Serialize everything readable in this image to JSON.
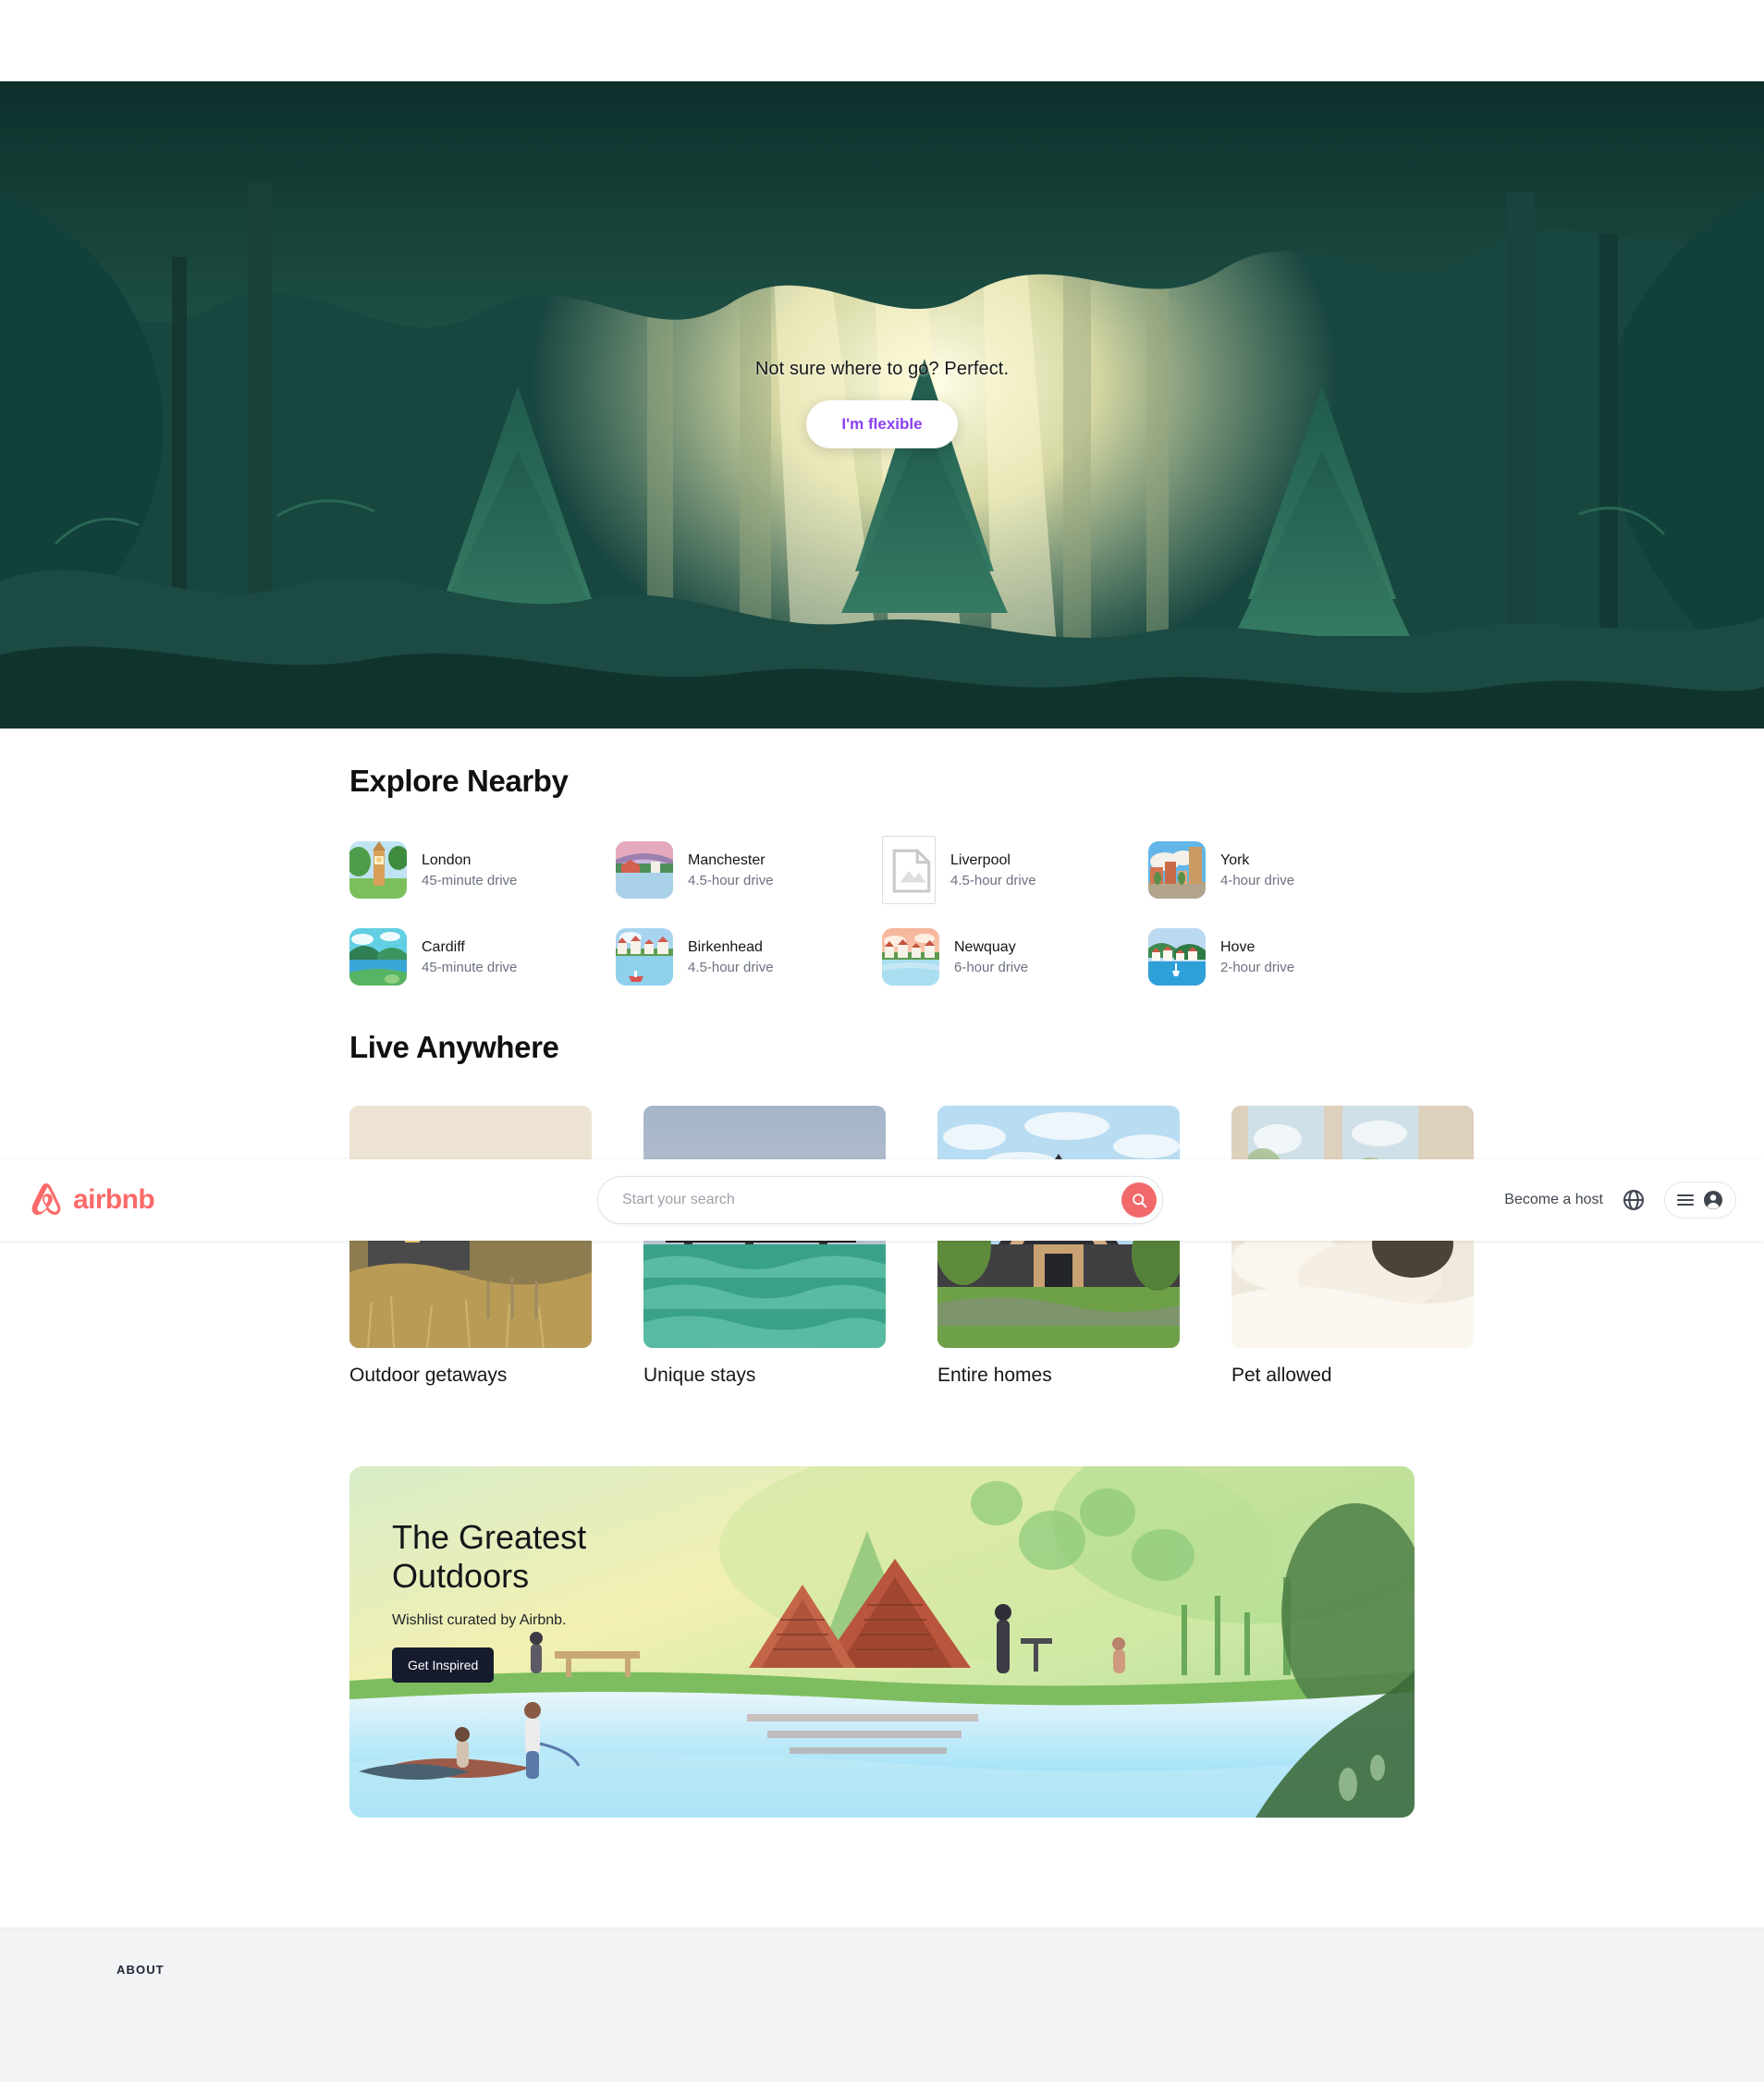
{
  "hero": {
    "caption": "Not sure where to go? Perfect.",
    "cta_label": "I'm flexible"
  },
  "explore": {
    "title": "Explore Nearby",
    "cities": [
      {
        "name": "London",
        "distance": "45-minute drive",
        "thumb": "london-thumb"
      },
      {
        "name": "Manchester",
        "distance": "4.5-hour drive",
        "thumb": "manchester-thumb"
      },
      {
        "name": "Liverpool",
        "distance": "4.5-hour drive",
        "thumb": "broken-image"
      },
      {
        "name": "York",
        "distance": "4-hour drive",
        "thumb": "york-thumb"
      },
      {
        "name": "Cardiff",
        "distance": "45-minute drive",
        "thumb": "cardiff-thumb"
      },
      {
        "name": "Birkenhead",
        "distance": "4.5-hour drive",
        "thumb": "birkenhead-thumb"
      },
      {
        "name": "Newquay",
        "distance": "6-hour drive",
        "thumb": "newquay-thumb"
      },
      {
        "name": "Hove",
        "distance": "2-hour drive",
        "thumb": "hove-thumb"
      }
    ]
  },
  "live_anywhere": {
    "title": "Live Anywhere",
    "cards": [
      {
        "label": "Outdoor getaways"
      },
      {
        "label": "Unique stays"
      },
      {
        "label": "Entire homes"
      },
      {
        "label": "Pet allowed"
      }
    ]
  },
  "promo": {
    "title_line1": "The Greatest",
    "title_line2": "Outdoors",
    "subtitle": "Wishlist curated by Airbnb.",
    "button_label": "Get Inspired"
  },
  "footer": {
    "heading": "ABOUT"
  },
  "navbar": {
    "brand": "airbnb",
    "search_placeholder": "Start your search",
    "search_value": "",
    "host_label": "Become a host",
    "globe_icon": "globe-icon",
    "menu_icon": "hamburger-icon",
    "avatar_icon": "user-avatar-icon",
    "search_icon": "search-icon"
  },
  "colors": {
    "brand": "#fb6a69",
    "search_button": "#f1696b",
    "flexible_text": "#8b3ff0",
    "promo_button": "#161b2e",
    "footer_bg": "#f2f3f5"
  }
}
